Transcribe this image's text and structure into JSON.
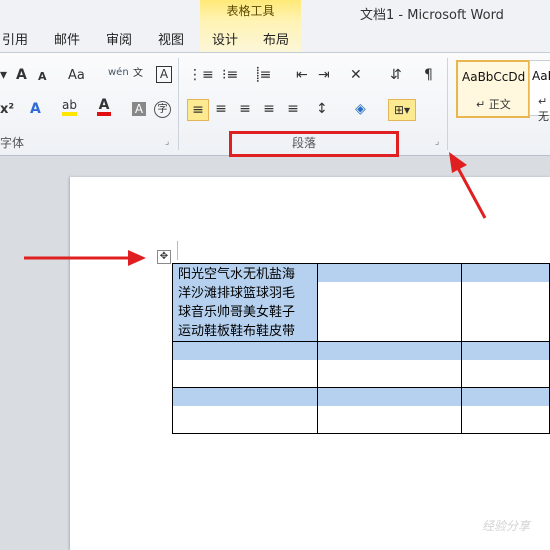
{
  "window": {
    "doc_title": "文档1  -  Microsoft Word",
    "context_tab_group": "表格工具"
  },
  "tabs": [
    "引用",
    "邮件",
    "审阅",
    "视图",
    "设计",
    "布局"
  ],
  "ribbon": {
    "font_group_label": "字体",
    "paragraph_group_label": "段落",
    "style_preview_1": "AaBbCcDd",
    "style_name_1": "↵ 正文",
    "style_preview_2": "AaB",
    "style_name_2": "↵ 无",
    "font_buttons": [
      "A",
      "A",
      "Aa",
      "wén",
      "A",
      "x²",
      "A",
      "ab",
      "A",
      "A",
      "字"
    ],
    "paragraph_buttons": [
      "≡",
      "≡",
      "≡",
      "≡",
      "≡",
      "↕",
      "⇵",
      "¶",
      "✕"
    ]
  },
  "document": {
    "table_cell_text": "阳光空气水无机盐海\n洋沙滩排球篮球羽毛\n球音乐帅哥美女鞋子\n运动鞋板鞋布鞋皮带"
  },
  "watermark": "经验分享"
}
